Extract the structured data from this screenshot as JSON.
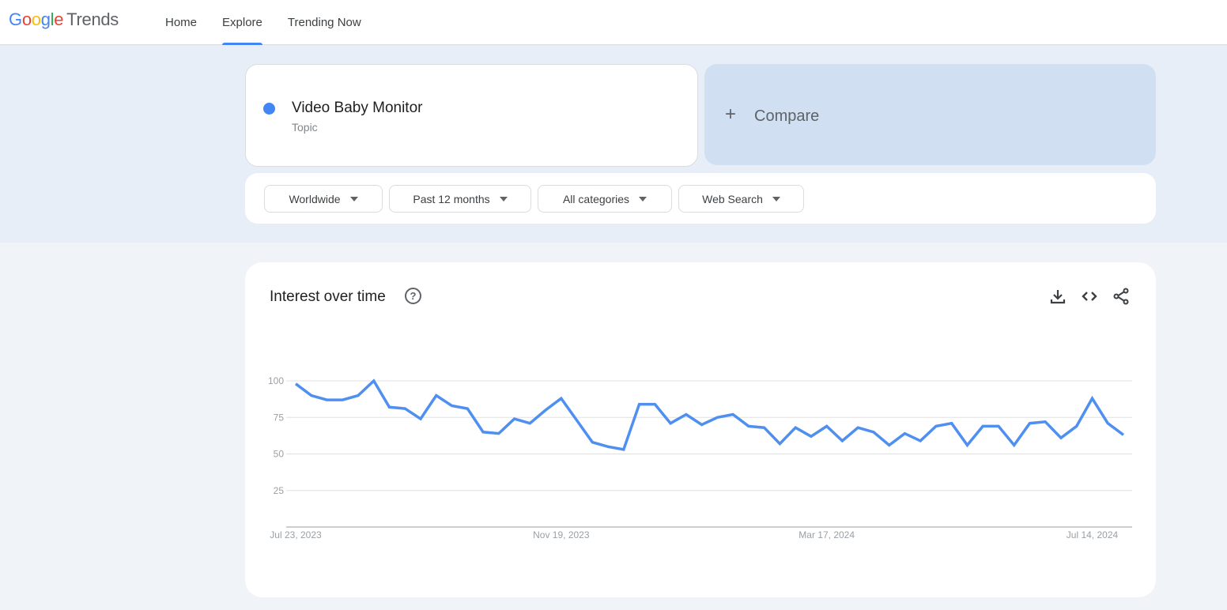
{
  "header": {
    "logo": {
      "google_letters": [
        {
          "char": "G",
          "color": "#4285f4"
        },
        {
          "char": "o",
          "color": "#ea4335"
        },
        {
          "char": "o",
          "color": "#fbbc05"
        },
        {
          "char": "g",
          "color": "#4285f4"
        },
        {
          "char": "l",
          "color": "#34a853"
        },
        {
          "char": "e",
          "color": "#ea4335"
        }
      ],
      "product": "Trends"
    },
    "nav": [
      {
        "label": "Home",
        "active": false
      },
      {
        "label": "Explore",
        "active": true
      },
      {
        "label": "Trending Now",
        "active": false
      }
    ]
  },
  "search_term": {
    "name": "Video Baby Monitor",
    "type": "Topic",
    "color": "#4285f4"
  },
  "compare": {
    "icon": "plus-icon",
    "label": "Compare"
  },
  "filters": [
    {
      "label": "Worldwide",
      "icon": "caret-down-icon"
    },
    {
      "label": "Past 12 months",
      "icon": "caret-down-icon"
    },
    {
      "label": "All categories",
      "icon": "caret-down-icon"
    },
    {
      "label": "Web Search",
      "icon": "caret-down-icon"
    }
  ],
  "interest_card": {
    "title": "Interest over time",
    "help_icon": "help-circle-icon",
    "actions": [
      {
        "name": "download",
        "icon": "download-icon"
      },
      {
        "name": "embed",
        "icon": "code-icon"
      },
      {
        "name": "share",
        "icon": "share-icon"
      }
    ]
  },
  "chart_data": {
    "type": "line",
    "title": "Interest over time",
    "xlabel": "",
    "ylabel": "",
    "ylim": [
      0,
      100
    ],
    "yticks": [
      100,
      75,
      50,
      25
    ],
    "xtick_labels": [
      {
        "label": "Jul 23, 2023",
        "index": 0
      },
      {
        "label": "Nov 19, 2023",
        "index": 17
      },
      {
        "label": "Mar 17, 2024",
        "index": 34
      },
      {
        "label": "Jul 14, 2024",
        "index": 51
      }
    ],
    "grid": true,
    "series": [
      {
        "name": "Video Baby Monitor",
        "color": "#4e8ff0",
        "values": [
          98,
          90,
          87,
          87,
          90,
          100,
          82,
          81,
          74,
          90,
          83,
          81,
          65,
          64,
          74,
          71,
          80,
          88,
          73,
          58,
          55,
          53,
          84,
          84,
          71,
          77,
          70,
          75,
          77,
          69,
          68,
          57,
          68,
          62,
          69,
          59,
          68,
          65,
          56,
          64,
          59,
          69,
          71,
          56,
          69,
          69,
          56,
          71,
          72,
          61,
          69,
          88,
          71,
          63
        ]
      }
    ]
  }
}
